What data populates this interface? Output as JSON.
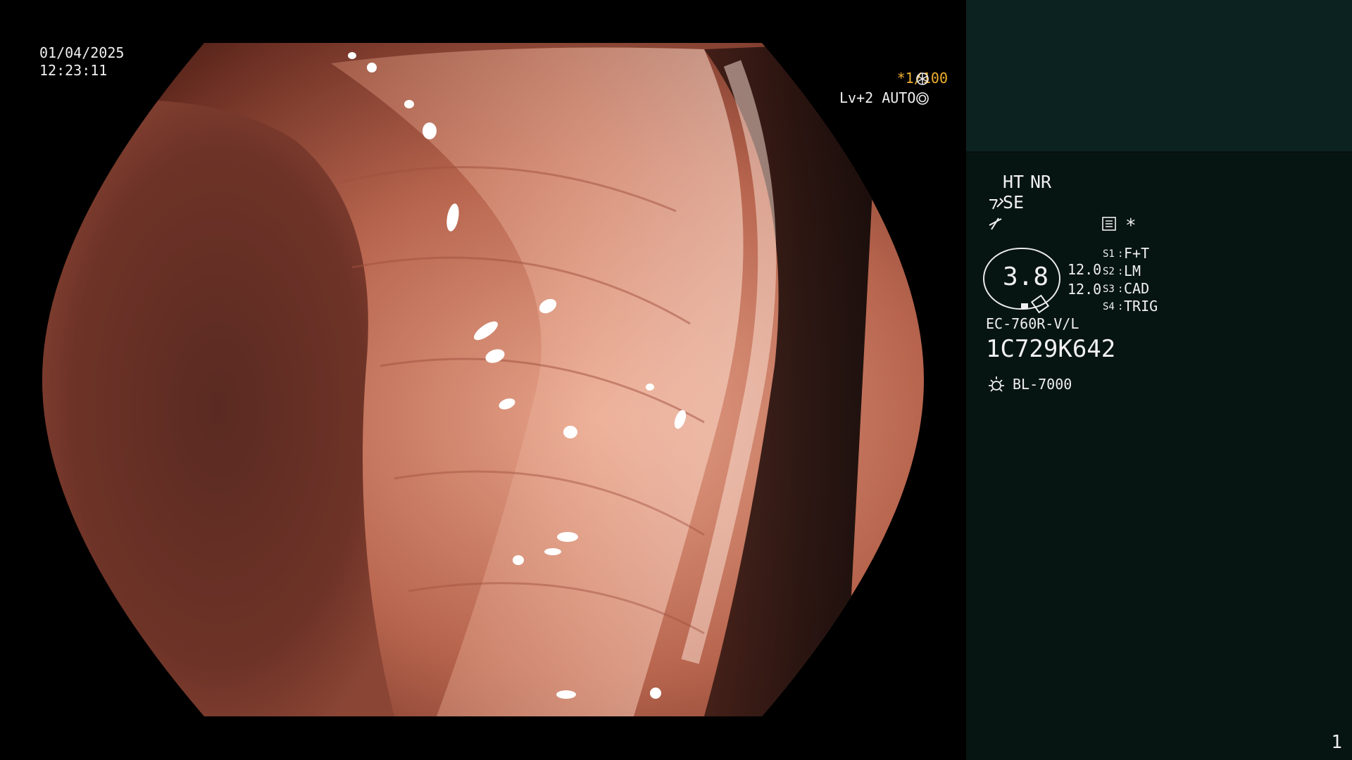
{
  "overlay": {
    "date": "01/04/2025",
    "time": "12:23:11",
    "shutter": "*1/100",
    "level_mode": "Lv+2 AUTO"
  },
  "panel": {
    "enhance_ht": "HT",
    "enhance_nr": "NR",
    "structure_se": "SE",
    "star_marker": "*",
    "zoom_value": "3.8",
    "zoom_line1": "12.0",
    "zoom_line2": "12.0",
    "switches": [
      {
        "key": "S1",
        "value": "F+T"
      },
      {
        "key": "S2",
        "value": "LM"
      },
      {
        "key": "S3",
        "value": "CAD"
      },
      {
        "key": "S4",
        "value": "TRIG"
      }
    ],
    "scope_model": "EC-760R-V/L",
    "scope_serial": "1C729K642",
    "light_source": "BL-7000"
  },
  "page_number": "1",
  "icons": [
    "aperture-icon",
    "iris-icon",
    "pen-icon",
    "wave-icon",
    "menu-icon",
    "sun-icon"
  ],
  "colors": {
    "accent": "#f0b030",
    "panel_bg": "#061412",
    "panel_top": "#0c2220"
  }
}
